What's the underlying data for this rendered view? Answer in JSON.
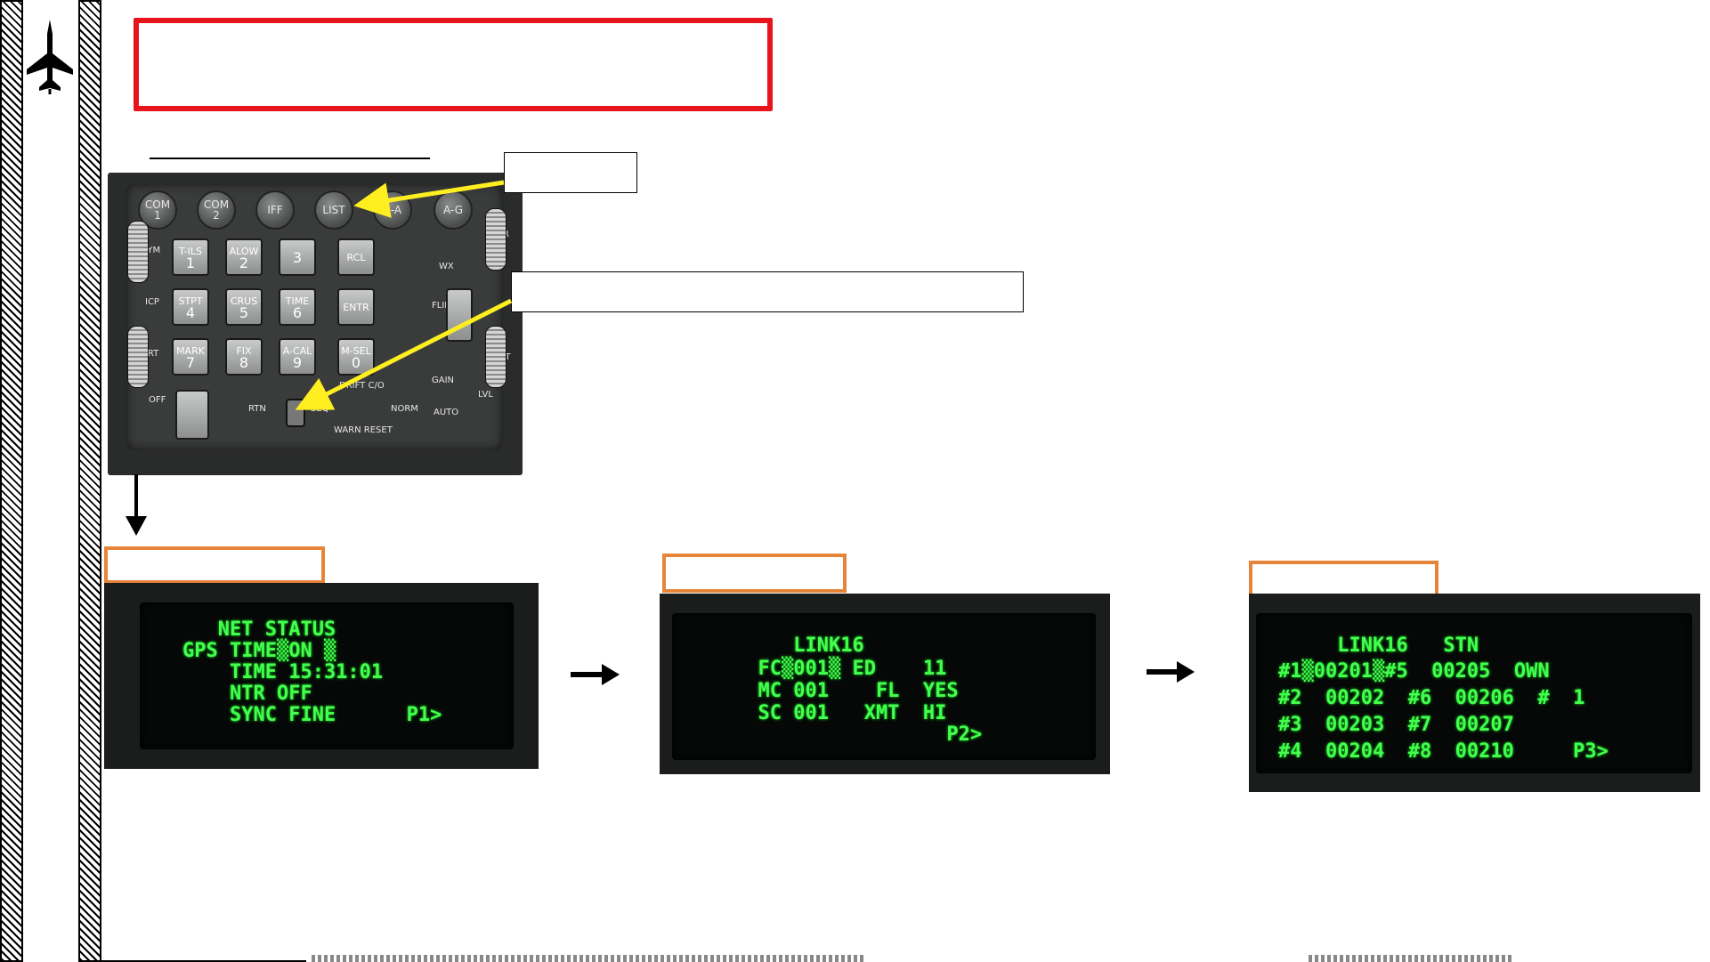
{
  "sidebar": {
    "icon": "jet-silhouette-icon"
  },
  "icp": {
    "top_buttons": [
      "COM\n1",
      "COM\n2",
      "IFF",
      "LIST",
      "A-A",
      "A-G"
    ],
    "keys": [
      {
        "label": "T-ILS",
        "num": "1"
      },
      {
        "label": "ALOW",
        "num": "2"
      },
      {
        "label": "",
        "num": "3"
      },
      {
        "label": "RCL",
        "num": ""
      },
      {
        "label": "STPT",
        "num": "4"
      },
      {
        "label": "CRUS",
        "num": "5"
      },
      {
        "label": "TIME",
        "num": "6"
      },
      {
        "label": "ENTR",
        "num": ""
      },
      {
        "label": "MARK",
        "num": "7"
      },
      {
        "label": "FIX",
        "num": "8"
      },
      {
        "label": "A-CAL",
        "num": "9"
      },
      {
        "label": "M-SEL",
        "num": "0"
      }
    ],
    "side_labels": {
      "sym": "SYM",
      "brt": "BRT",
      "icp": "ICP",
      "depr": "DEPR",
      "flir": "FLIR",
      "cont": "CONT",
      "wx": "WX",
      "gain": "GAIN",
      "lvl": "LVL",
      "auto": "AUTO",
      "off": "OFF",
      "rtn": "RTN",
      "seq": "SEQ",
      "drift": "DRIFT C/O",
      "norm": "NORM",
      "warn_reset": "WARN RESET"
    }
  },
  "displays": [
    {
      "lines": [
        "   NET STATUS",
        "GPS TIME▒ON ▒",
        "    TIME 15:31:01",
        "    NTR OFF",
        "    SYNC FINE      P1>"
      ]
    },
    {
      "lines": [
        "     LINK16",
        "  FC▒001▒ ED    11",
        "  MC 001    FL  YES",
        "  SC 001   XMT  HI",
        "                  P2>"
      ]
    },
    {
      "lines": [
        "     LINK16   STN",
        "#1▒00201▒#5  00205  OWN",
        "#2  00202  #6  00206  #  1",
        "#3  00203  #7  00207",
        "#4  00204  #8  00210     P3>"
      ]
    }
  ],
  "colors": {
    "title_border": "#e8141b",
    "ded_text": "#43ff4e",
    "step_box": "#e6853a",
    "pointer_arrow": "#ffee20"
  }
}
